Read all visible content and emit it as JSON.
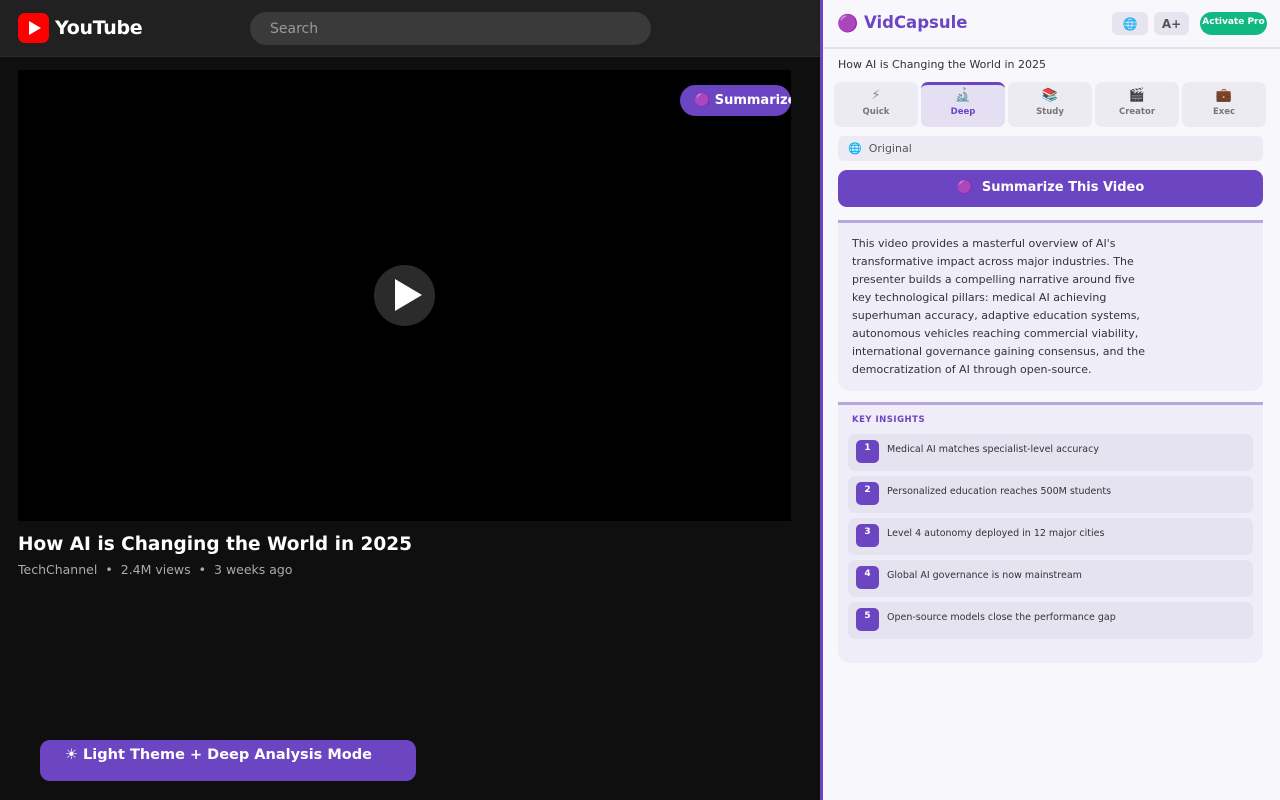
{
  "youtube": {
    "logo_text": "YouTube",
    "search_placeholder": "Search",
    "summarize_button": "🟣 Summarize",
    "video": {
      "title": "How AI is Changing the World in 2025",
      "channel": "TechChannel",
      "views": "2.4M views",
      "age": "3 weeks ago",
      "separator": "•"
    },
    "demo_banner": "☀ Light Theme + Deep Analysis Mode"
  },
  "panel": {
    "brand_icon": "🟣",
    "brand_name": "VidCapsule",
    "lang_button": "🌐",
    "font_button": "A+",
    "activate_button": "Activate Pro",
    "video_title": "How AI is Changing the World in 2025",
    "modes": [
      {
        "icon": "⚡",
        "label": "Quick"
      },
      {
        "icon": "🔬",
        "label": "Deep"
      },
      {
        "icon": "📚",
        "label": "Study"
      },
      {
        "icon": "🎬",
        "label": "Creator"
      },
      {
        "icon": "💼",
        "label": "Exec"
      }
    ],
    "active_mode": "Deep",
    "language": {
      "icon": "🌐",
      "value": "Original"
    },
    "summarize_button": {
      "icon": "🟣",
      "label": "Summarize This Video"
    },
    "summary": "This video provides a masterful overview of AI's transformative impact across major industries. The presenter builds a compelling narrative around five key technological pillars: medical AI achieving superhuman accuracy, adaptive education systems, autonomous vehicles reaching commercial viability, international governance gaining consensus, and the democratization of AI through open-source.",
    "insights_heading": "KEY INSIGHTS",
    "insights": [
      {
        "num": "1",
        "text": "Medical AI matches specialist-level accuracy"
      },
      {
        "num": "2",
        "text": "Personalized education reaches 500M students"
      },
      {
        "num": "3",
        "text": "Level 4 autonomy deployed in 12 major cities"
      },
      {
        "num": "4",
        "text": "Global AI governance is now mainstream"
      },
      {
        "num": "5",
        "text": "Open-source models close the performance gap"
      }
    ]
  },
  "colors": {
    "accent": "#6b45c2",
    "activate": "#10b981",
    "youtube_red": "#ff0000"
  }
}
